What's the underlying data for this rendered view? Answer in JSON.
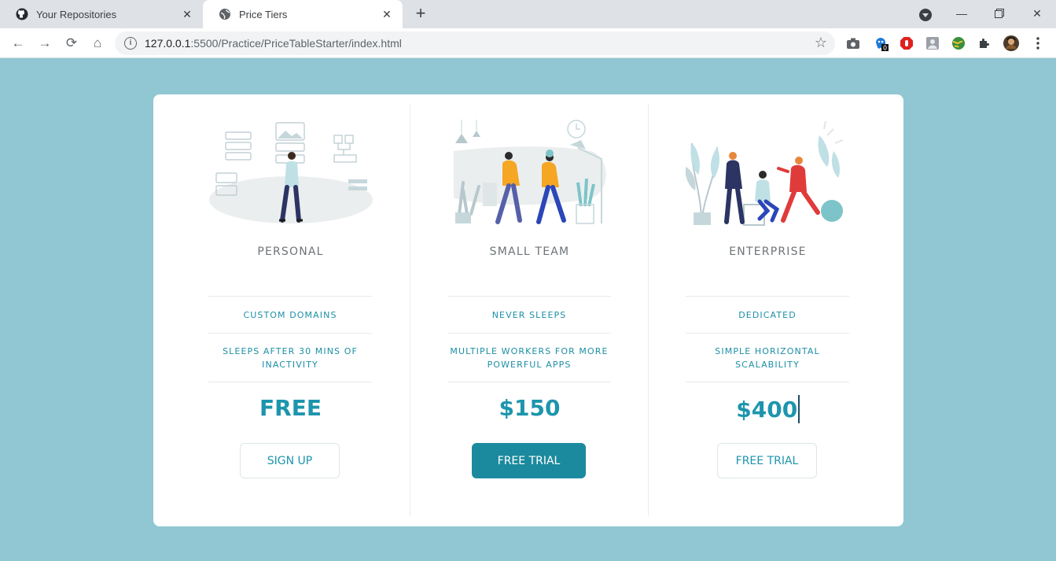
{
  "browser": {
    "tabs": [
      {
        "title": "Your Repositories",
        "icon": "github-icon",
        "active": false
      },
      {
        "title": "Price Tiers",
        "icon": "globe-icon",
        "active": true
      }
    ],
    "url_host": "127.0.0.1",
    "url_path": ":5500/Practice/PriceTableStarter/index.html",
    "extension_badge": "0"
  },
  "plans": [
    {
      "name": "PERSONAL",
      "features": [
        "CUSTOM DOMAINS",
        "SLEEPS AFTER 30 MINS OF INACTIVITY"
      ],
      "price": "FREE",
      "cta": "SIGN UP",
      "cta_style": "outline"
    },
    {
      "name": "SMALL TEAM",
      "features": [
        "NEVER SLEEPS",
        "MULTIPLE WORKERS FOR MORE POWERFUL APPS"
      ],
      "price": "$150",
      "cta": "FREE TRIAL",
      "cta_style": "filled"
    },
    {
      "name": "ENTERPRISE",
      "features": [
        "DEDICATED",
        "SIMPLE HORIZONTAL SCALABILITY"
      ],
      "price": "$400",
      "cta": "FREE TRIAL",
      "cta_style": "outline"
    }
  ],
  "colors": {
    "page_background": "#91c7d2",
    "accent": "#1d95ad",
    "button_filled": "#1c8a9e",
    "card": "#ffffff"
  }
}
